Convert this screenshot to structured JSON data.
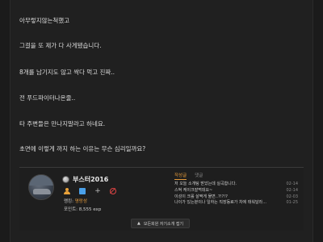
{
  "post": {
    "paragraphs": [
      "아무렇지않는척했고",
      "그걸을 또 제가 다 사게됐습니다.",
      "8개를 남기지도 않고 싹다 먹고 진짜..",
      "전 푸드파이터나온줄..",
      "타 주변들은 만나지말라고 하네요.",
      "초면에 이렇게 까지 하는 이유는 무슨 심리일까요?"
    ]
  },
  "author": {
    "nickname": "부스터2016",
    "rank_label": "랭킹:",
    "rank_value": "명랑성",
    "points_text": "포인트: 8,555 exp",
    "tabs": {
      "posts": "작성글",
      "comments": "댓글"
    },
    "recent_posts": [
      {
        "title": "저 오늘 소개팅 받았는데 실곡합니다.",
        "date": "02-14"
      },
      {
        "title": "스벅 케이크잘먹데요~",
        "date": "02-14"
      },
      {
        "title": "이성이 크롤 살짝게 물면..?!?!?",
        "date": "02-03"
      },
      {
        "title": "나이가 있는분이나 일하는 직장동료가 차에 태워달라...",
        "date": "01-25"
      }
    ],
    "expand_button": "모든회원 자기소개 접기"
  }
}
